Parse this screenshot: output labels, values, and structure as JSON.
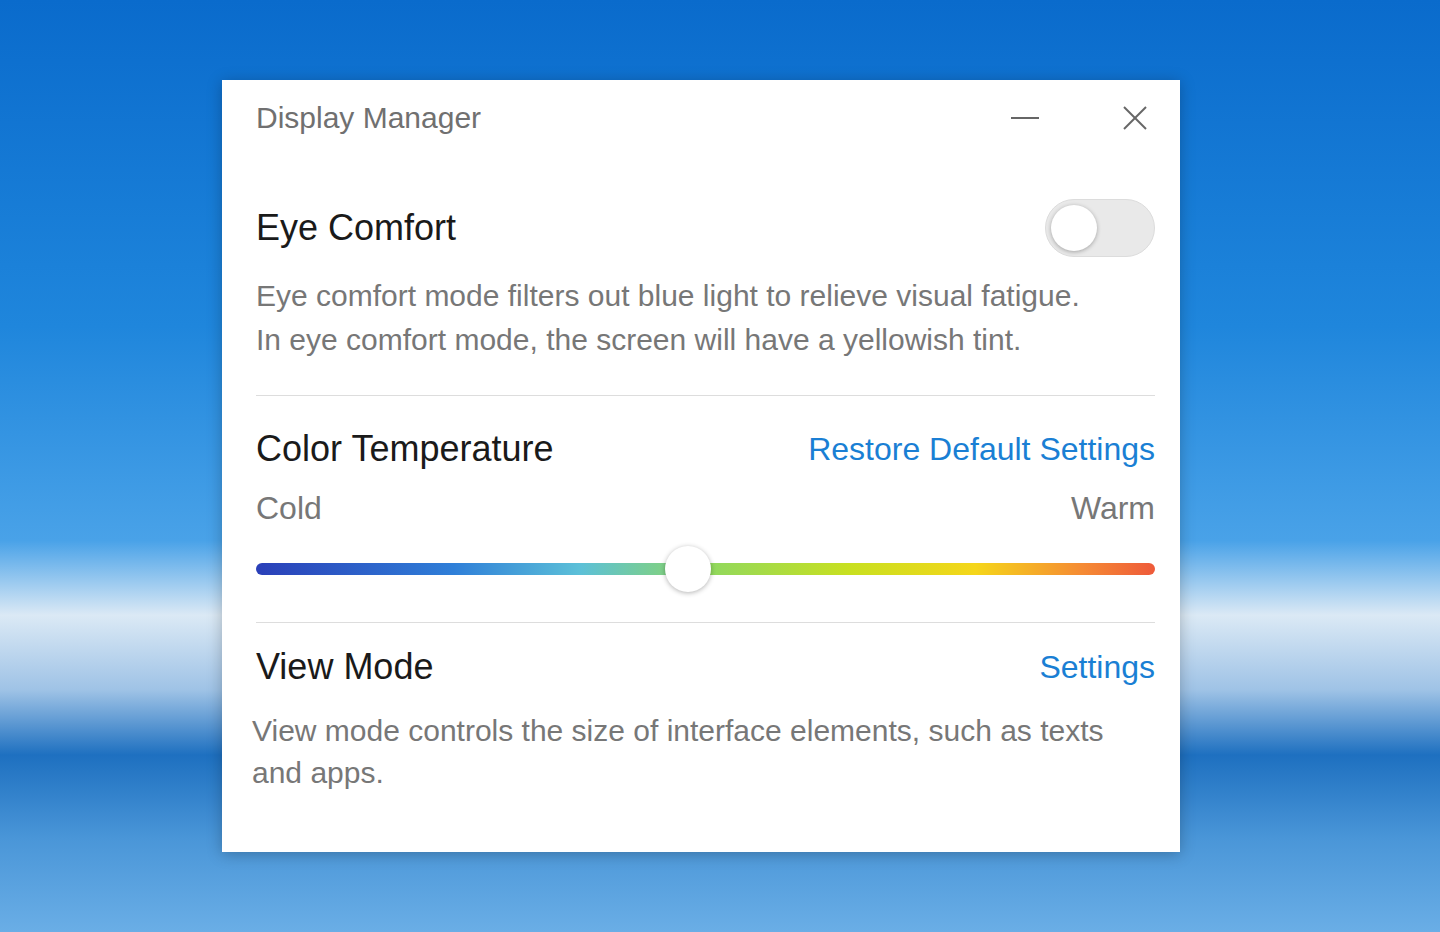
{
  "window": {
    "title": "Display Manager"
  },
  "eye_comfort": {
    "title": "Eye Comfort",
    "on": false,
    "description": [
      "Eye comfort mode filters out blue light to relieve visual fatigue.",
      "In eye comfort mode, the screen will have a yellowish tint."
    ]
  },
  "color_temperature": {
    "title": "Color Temperature",
    "restore_link": "Restore Default Settings",
    "min_label": "Cold",
    "max_label": "Warm",
    "level": 0.48
  },
  "view_mode": {
    "title": "View Mode",
    "settings_link": "Settings",
    "description": "View mode controls the size of interface elements, such as texts and apps."
  }
}
